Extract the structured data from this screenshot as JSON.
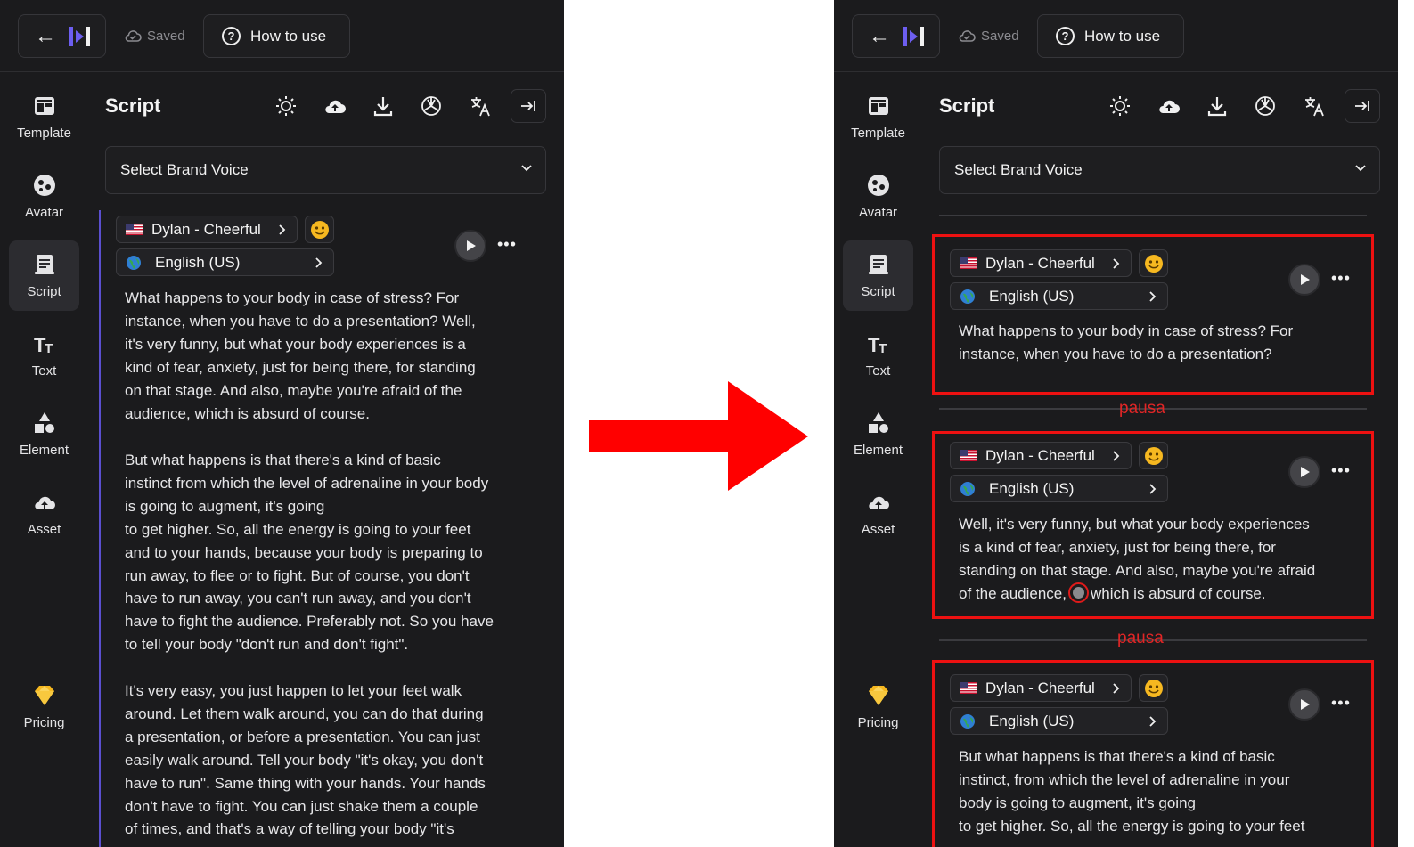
{
  "topbar": {
    "saved_label": "Saved",
    "howto_label": "How to use"
  },
  "sidebar": {
    "items": [
      {
        "label": "Template",
        "icon": "template-icon"
      },
      {
        "label": "Avatar",
        "icon": "avatar-icon"
      },
      {
        "label": "Script",
        "icon": "script-icon",
        "active": true
      },
      {
        "label": "Text",
        "icon": "text-icon"
      },
      {
        "label": "Element",
        "icon": "element-icon"
      },
      {
        "label": "Asset",
        "icon": "asset-icon"
      },
      {
        "label": "Pricing",
        "icon": "diamond-icon"
      }
    ]
  },
  "script": {
    "title": "Script",
    "toolbar_icons": [
      "sun-icon",
      "cloud-upload-icon",
      "download-icon",
      "openai-icon",
      "translate-icon",
      "collapse-icon"
    ],
    "brand_voice_placeholder": "Select Brand Voice"
  },
  "voice": {
    "name": "Dylan - Cheerful",
    "language": "English (US)"
  },
  "left_panel": {
    "paragraphs": [
      [
        "What happens to your body in case of stress? For",
        "instance, when you have to do a presentation? Well,",
        "it's very funny, but what your body experiences is a",
        "kind of fear, anxiety, just for being there, for standing",
        "on that stage. And also, maybe you're afraid of the",
        "audience, which is absurd of course."
      ],
      [
        "But what happens is that there's a kind of basic",
        "instinct from which the level of adrenaline in your body",
        "is going to augment, it's going",
        "to get higher. So, all the energy is going to your feet",
        "and to your hands, because your body is preparing to",
        "run away, to flee or to fight. But of course, you don't",
        "have to run away, you can't run away, and you don't",
        "have to fight the audience. Preferably not. So you have",
        "to tell your body \"don't run and don't fight\"."
      ],
      [
        "It's very easy, you just happen to let your feet walk",
        "around. Let them walk around, you can do that during",
        "a presentation, or before a presentation. You can just",
        "easily walk around. Tell your body \"it's okay, you don't",
        "have to run\". Same thing with your hands. Your hands",
        "don't have to fight. You can just shake them a couple",
        "of times, and that's a way of telling your body \"it's"
      ]
    ]
  },
  "right_panel": {
    "pause_label": "pausa",
    "blocks": [
      {
        "lines": [
          "What happens to your body in case of stress? For",
          "instance, when you have to do a presentation?"
        ]
      },
      {
        "lines": [
          "Well, it's very funny, but what your body experiences",
          "is a kind of fear, anxiety, just for being there, for",
          "standing on that stage. And also, maybe you're afraid"
        ],
        "last_line_before_pause": "of the audience,",
        "last_line_after_pause": "which is absurd of course."
      },
      {
        "lines": [
          "But what happens is that there's a kind of basic",
          "instinct, from which the level of adrenaline in your",
          "body is going to augment, it's going",
          "to get higher. So, all the energy is going to your feet"
        ]
      }
    ]
  },
  "colors": {
    "accent": "#5b4fd0",
    "highlight": "#ee1111",
    "panel_bg": "#1b1b1d"
  }
}
